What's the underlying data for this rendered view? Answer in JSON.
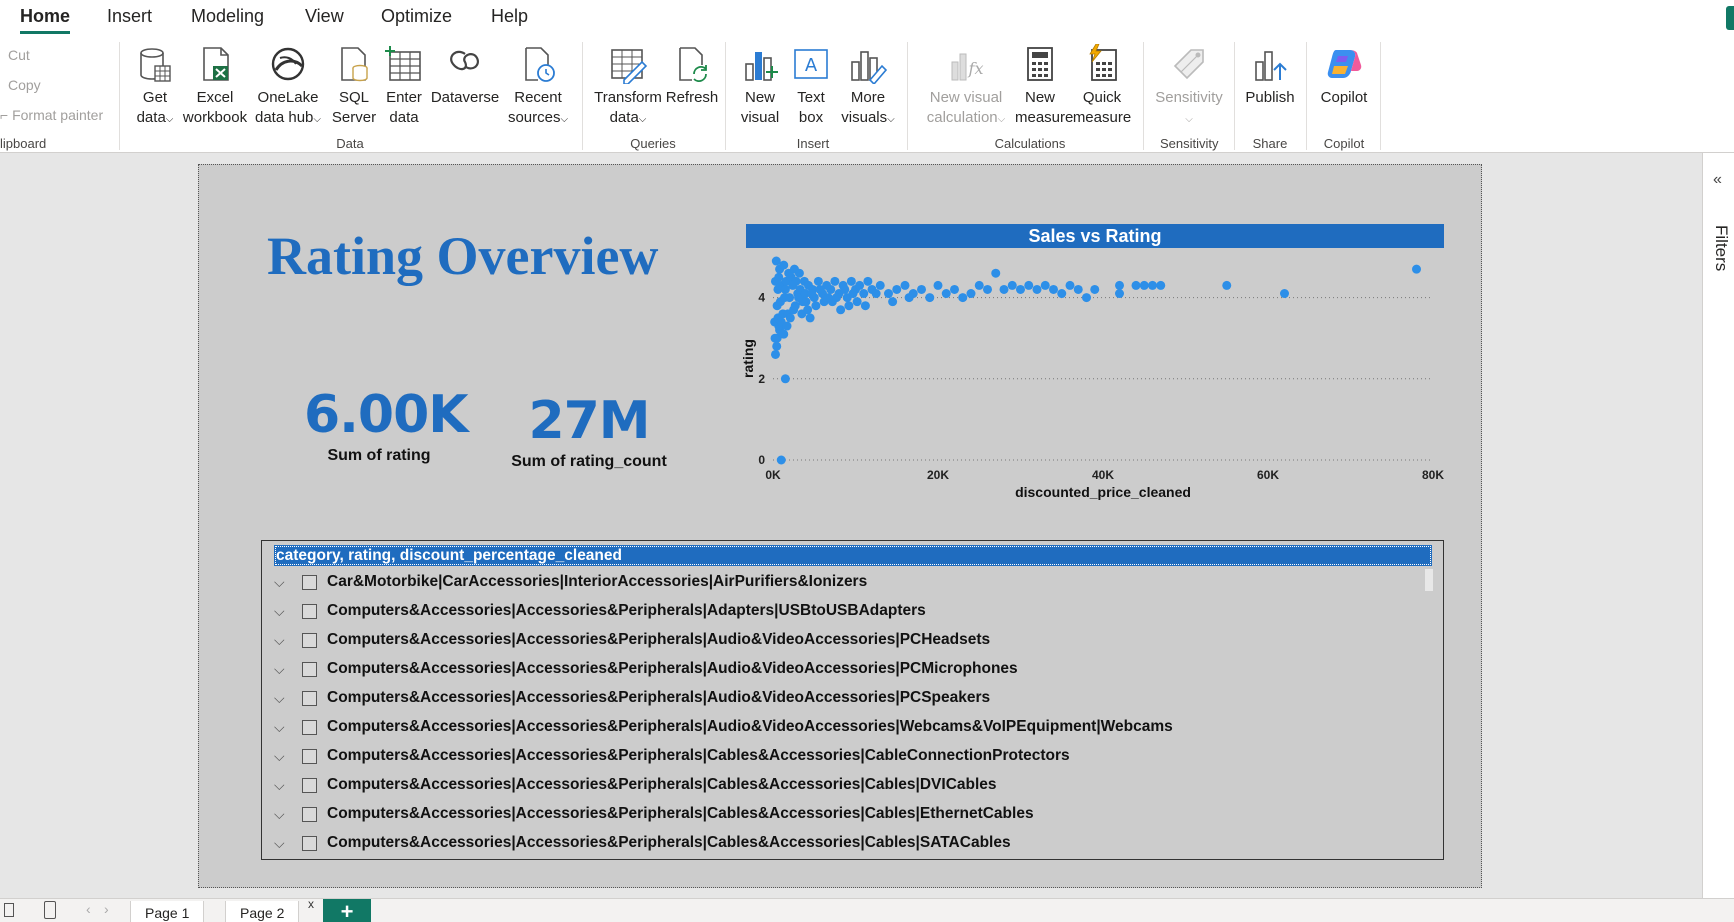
{
  "tabs": [
    "Home",
    "Insert",
    "Modeling",
    "View",
    "Optimize",
    "Help"
  ],
  "clipboard": {
    "cut": "Cut",
    "copy": "Copy",
    "format_painter": "Format painter",
    "group": "lipboard"
  },
  "ribbon": {
    "get_data": [
      "Get",
      "data"
    ],
    "excel": [
      "Excel",
      "workbook"
    ],
    "onelake": [
      "OneLake",
      "data hub"
    ],
    "sql": [
      "SQL",
      "Server"
    ],
    "enter": [
      "Enter",
      "data"
    ],
    "dataverse": "Dataverse",
    "recent": [
      "Recent",
      "sources"
    ],
    "transform": [
      "Transform",
      "data"
    ],
    "refresh": "Refresh",
    "new_visual": [
      "New",
      "visual"
    ],
    "text_box": [
      "Text",
      "box"
    ],
    "more_visuals": [
      "More",
      "visuals"
    ],
    "new_visual_calc": [
      "New visual",
      "calculation"
    ],
    "new_measure": [
      "New",
      "measure"
    ],
    "quick_measure": [
      "Quick",
      "measure"
    ],
    "sensitivity": "Sensitivity",
    "publish": "Publish",
    "copilot": "Copilot"
  },
  "groups": {
    "data": "Data",
    "queries": "Queries",
    "insert": "Insert",
    "calculations": "Calculations",
    "sensitivity": "Sensitivity",
    "share": "Share",
    "copilot": "Copilot"
  },
  "report": {
    "title": "Rating Overview",
    "card1": {
      "value": "6.00K",
      "label": "Sum of rating"
    },
    "card2": {
      "value": "27M",
      "label": "Sum of rating_count"
    }
  },
  "chart_data": {
    "type": "scatter",
    "title": "Sales vs Rating",
    "xlabel": "discounted_price_cleaned",
    "ylabel": "rating",
    "xlim": [
      0,
      80000
    ],
    "ylim": [
      0,
      5
    ],
    "x_ticks": [
      "0K",
      "20K",
      "40K",
      "60K",
      "80K"
    ],
    "y_ticks": [
      "0",
      "2",
      "4"
    ],
    "grid": true,
    "color": "#2d8fe8",
    "points": [
      [
        1000,
        0
      ],
      [
        1500,
        2.0
      ],
      [
        300,
        2.6
      ],
      [
        500,
        3.0
      ],
      [
        800,
        3.2
      ],
      [
        200,
        3.4
      ],
      [
        600,
        3.5
      ],
      [
        1200,
        3.6
      ],
      [
        1800,
        3.6
      ],
      [
        2500,
        3.7
      ],
      [
        3500,
        3.6
      ],
      [
        4500,
        3.5
      ],
      [
        500,
        3.8
      ],
      [
        900,
        3.9
      ],
      [
        1400,
        4.0
      ],
      [
        2000,
        4.0
      ],
      [
        3000,
        4.1
      ],
      [
        4000,
        3.9
      ],
      [
        5000,
        4.0
      ],
      [
        6000,
        4.1
      ],
      [
        7000,
        4.2
      ],
      [
        8000,
        4.1
      ],
      [
        9000,
        4.0
      ],
      [
        10000,
        4.2
      ],
      [
        11000,
        4.1
      ],
      [
        12000,
        4.2
      ],
      [
        13000,
        4.3
      ],
      [
        14000,
        4.1
      ],
      [
        15000,
        4.2
      ],
      [
        16000,
        4.3
      ],
      [
        17000,
        4.1
      ],
      [
        18000,
        4.2
      ],
      [
        19000,
        4.0
      ],
      [
        20000,
        4.3
      ],
      [
        21000,
        4.1
      ],
      [
        22000,
        4.2
      ],
      [
        23000,
        4.0
      ],
      [
        24000,
        4.1
      ],
      [
        25000,
        4.3
      ],
      [
        26000,
        4.2
      ],
      [
        27000,
        4.6
      ],
      [
        28000,
        4.2
      ],
      [
        29000,
        4.3
      ],
      [
        30000,
        4.2
      ],
      [
        31000,
        4.3
      ],
      [
        32000,
        4.2
      ],
      [
        33000,
        4.3
      ],
      [
        34000,
        4.2
      ],
      [
        35000,
        4.1
      ],
      [
        36000,
        4.3
      ],
      [
        37000,
        4.2
      ],
      [
        38000,
        4.0
      ],
      [
        39000,
        4.2
      ],
      [
        42000,
        4.3
      ],
      [
        42000,
        4.1
      ],
      [
        44000,
        4.3
      ],
      [
        45000,
        4.3
      ],
      [
        46000,
        4.3
      ],
      [
        47000,
        4.3
      ],
      [
        55000,
        4.3
      ],
      [
        62000,
        4.1
      ],
      [
        78000,
        4.7
      ],
      [
        300,
        4.4
      ],
      [
        700,
        4.5
      ],
      [
        1100,
        4.3
      ],
      [
        1600,
        4.4
      ],
      [
        2200,
        4.5
      ],
      [
        2800,
        4.4
      ],
      [
        3300,
        4.2
      ],
      [
        3800,
        4.4
      ],
      [
        4300,
        4.3
      ],
      [
        4800,
        4.2
      ],
      [
        5500,
        4.4
      ],
      [
        6500,
        4.3
      ],
      [
        7500,
        4.4
      ],
      [
        8500,
        4.3
      ],
      [
        9500,
        4.4
      ],
      [
        10500,
        4.3
      ],
      [
        11500,
        4.4
      ],
      [
        12500,
        4.1
      ],
      [
        400,
        4.9
      ],
      [
        800,
        4.7
      ],
      [
        1300,
        4.8
      ],
      [
        1900,
        4.6
      ],
      [
        2600,
        4.7
      ],
      [
        3200,
        4.6
      ],
      [
        250,
        3.0
      ],
      [
        450,
        2.8
      ],
      [
        700,
        3.3
      ],
      [
        1000,
        3.4
      ],
      [
        1300,
        3.1
      ],
      [
        1700,
        3.3
      ],
      [
        2100,
        3.5
      ],
      [
        2700,
        3.8
      ],
      [
        3600,
        3.9
      ],
      [
        4200,
        3.7
      ],
      [
        5200,
        3.8
      ],
      [
        6200,
        3.9
      ],
      [
        7200,
        3.9
      ],
      [
        8200,
        3.7
      ],
      [
        9200,
        3.8
      ],
      [
        10200,
        3.9
      ],
      [
        11200,
        3.8
      ],
      [
        14500,
        3.9
      ],
      [
        16500,
        4.0
      ],
      [
        600,
        4.2
      ],
      [
        1500,
        4.2
      ],
      [
        2400,
        4.3
      ],
      [
        3100,
        4.0
      ],
      [
        3900,
        4.1
      ],
      [
        4700,
        4.1
      ],
      [
        5700,
        4.2
      ],
      [
        6700,
        4.0
      ],
      [
        7700,
        4.0
      ],
      [
        8700,
        4.2
      ],
      [
        9700,
        4.1
      ]
    ]
  },
  "slicer": {
    "header": "category, rating, discount_percentage_cleaned",
    "items": [
      "Car&Motorbike|CarAccessories|InteriorAccessories|AirPurifiers&Ionizers",
      "Computers&Accessories|Accessories&Peripherals|Adapters|USBtoUSBAdapters",
      "Computers&Accessories|Accessories&Peripherals|Audio&VideoAccessories|PCHeadsets",
      "Computers&Accessories|Accessories&Peripherals|Audio&VideoAccessories|PCMicrophones",
      "Computers&Accessories|Accessories&Peripherals|Audio&VideoAccessories|PCSpeakers",
      "Computers&Accessories|Accessories&Peripherals|Audio&VideoAccessories|Webcams&VoIPEquipment|Webcams",
      "Computers&Accessories|Accessories&Peripherals|Cables&Accessories|CableConnectionProtectors",
      "Computers&Accessories|Accessories&Peripherals|Cables&Accessories|Cables|DVICables",
      "Computers&Accessories|Accessories&Peripherals|Cables&Accessories|Cables|EthernetCables",
      "Computers&Accessories|Accessories&Peripherals|Cables&Accessories|Cables|SATACables"
    ]
  },
  "right_pane": {
    "filters": "Filters"
  },
  "pages": [
    "Page 1",
    "Page 2"
  ],
  "add_page": "+"
}
